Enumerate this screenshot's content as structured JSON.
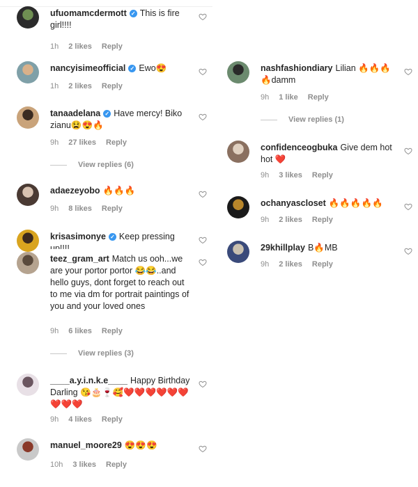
{
  "left": [
    {
      "user": "ufuomamcdermott",
      "verified": true,
      "text": "This is fire girl!!!!",
      "time": "1h",
      "likes": "2 likes",
      "reply": "Reply",
      "avatar": [
        "#2b2b2b",
        "#6f8f52"
      ]
    },
    {
      "user": "nancyisimeofficial",
      "verified": true,
      "text": "Ewo😍",
      "time": "1h",
      "likes": "2 likes",
      "reply": "Reply",
      "avatar": [
        "#7fa0a8",
        "#d9b18a"
      ]
    },
    {
      "user": "tanaadelana",
      "verified": true,
      "text": "Have mercy! Biko zianu😫😍🔥",
      "time": "9h",
      "likes": "27 likes",
      "reply": "Reply",
      "view_replies": "View replies (6)",
      "avatar": [
        "#c9a37a",
        "#3a2b22"
      ]
    },
    {
      "user": "adaezeyobo",
      "verified": false,
      "text": "🔥🔥🔥",
      "time": "9h",
      "likes": "8 likes",
      "reply": "Reply",
      "avatar": [
        "#4a3a33",
        "#d8c2b0"
      ]
    },
    {
      "user": "krisasimonye",
      "verified": true,
      "text": "Keep pressing up!!!!",
      "time": "",
      "likes": "",
      "reply": "",
      "avatar": [
        "#d9a41f",
        "#3d2a1d"
      ]
    },
    {
      "user": "teez_gram_art",
      "verified": false,
      "text": "Match us ooh...we are your portor portor 😂😂..and hello guys, dont forget to reach out to me via dm for portrait paintings of you and your loved ones",
      "time": "9h",
      "likes": "6 likes",
      "reply": "Reply",
      "view_replies": "View replies (3)",
      "avatar": [
        "#b5a38f",
        "#5a4a3c"
      ]
    },
    {
      "user": "____a.y.i.n.k.e____",
      "verified": false,
      "text": "Happy Birthday Darling 😘🎂🍷🥰❤️❤️❤️❤️❤️❤️❤️❤️❤️",
      "time": "9h",
      "likes": "4 likes",
      "reply": "Reply",
      "avatar": [
        "#e8e0e6",
        "#6b5660"
      ]
    },
    {
      "user": "manuel_moore29",
      "verified": false,
      "text": "😍😍😍",
      "time": "10h",
      "likes": "3 likes",
      "reply": "Reply",
      "avatar": [
        "#c9c9c9",
        "#8a3a2a"
      ]
    }
  ],
  "right": [
    {
      "user": "nashfashiondiary",
      "verified": false,
      "text": "Lilian 🔥🔥🔥🔥damm",
      "time": "9h",
      "likes": "1 like",
      "reply": "Reply",
      "view_replies": "View replies (1)",
      "avatar": [
        "#6b8a6e",
        "#2a2a2a"
      ]
    },
    {
      "user": "confidenceogbuka",
      "verified": false,
      "text": "Give dem hot hot ❤️",
      "time": "9h",
      "likes": "3 likes",
      "reply": "Reply",
      "avatar": [
        "#8a7060",
        "#e0d0c0"
      ]
    },
    {
      "user": "ochanyascloset",
      "verified": false,
      "text": "🔥🔥🔥🔥🔥",
      "time": "9h",
      "likes": "2 likes",
      "reply": "Reply",
      "avatar": [
        "#1a1a1a",
        "#b8862b"
      ]
    },
    {
      "user": "29khillplay",
      "verified": false,
      "text": "B🔥MB",
      "time": "9h",
      "likes": "2 likes",
      "reply": "Reply",
      "avatar": [
        "#3a4a7a",
        "#c9c0b0"
      ]
    }
  ],
  "colors": {
    "verified": "#3897f0",
    "muted": "#8e8e8e",
    "text": "#262626"
  },
  "icons": {
    "like": "heart-outline-icon",
    "verified": "verified-badge-icon"
  }
}
